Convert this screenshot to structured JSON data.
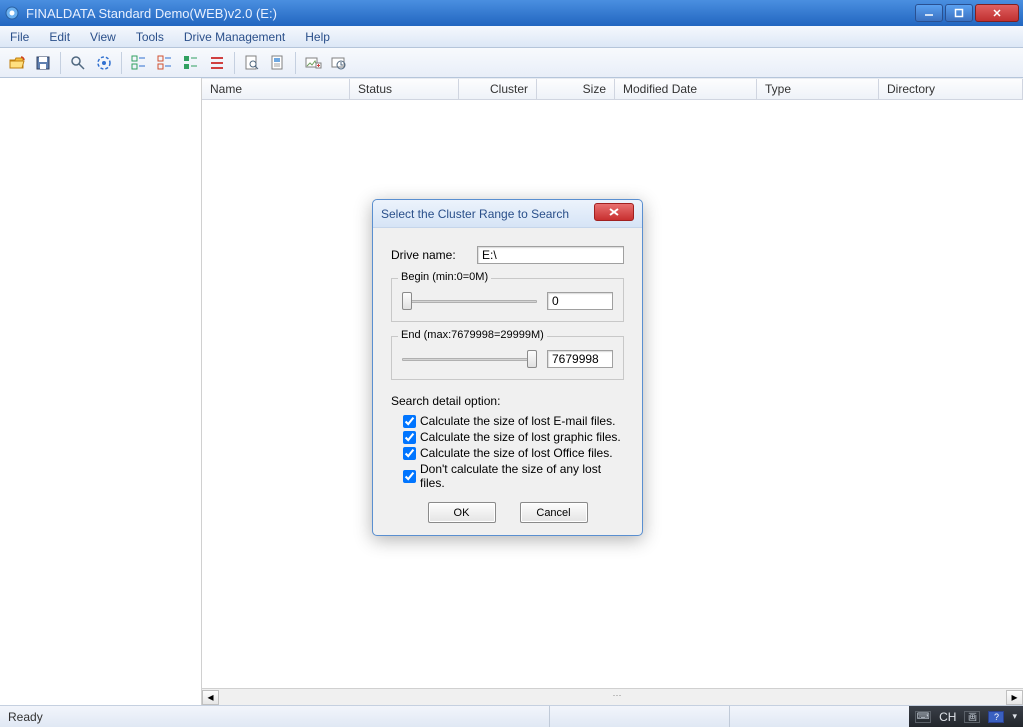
{
  "window": {
    "title": "FINALDATA Standard Demo(WEB)v2.0 (E:)"
  },
  "menu": {
    "items": [
      "File",
      "Edit",
      "View",
      "Tools",
      "Drive Management",
      "Help"
    ]
  },
  "columns": {
    "name": "Name",
    "status": "Status",
    "cluster": "Cluster",
    "size": "Size",
    "modified": "Modified Date",
    "type": "Type",
    "directory": "Directory"
  },
  "statusbar": {
    "text": "Ready",
    "tray_lang": "CH"
  },
  "dialog": {
    "title": "Select the Cluster Range to Search",
    "drive_label": "Drive name:",
    "drive_value": "E:\\",
    "begin_legend": "Begin (min:0=0M)",
    "begin_value": "0",
    "end_legend": "End (max:7679998=29999M)",
    "end_value": "7679998",
    "options_title": "Search detail option:",
    "options": [
      "Calculate the size of lost E-mail files.",
      "Calculate the size of lost graphic files.",
      "Calculate the size of lost Office files.",
      "Don't calculate the size of any lost files."
    ],
    "ok": "OK",
    "cancel": "Cancel"
  }
}
